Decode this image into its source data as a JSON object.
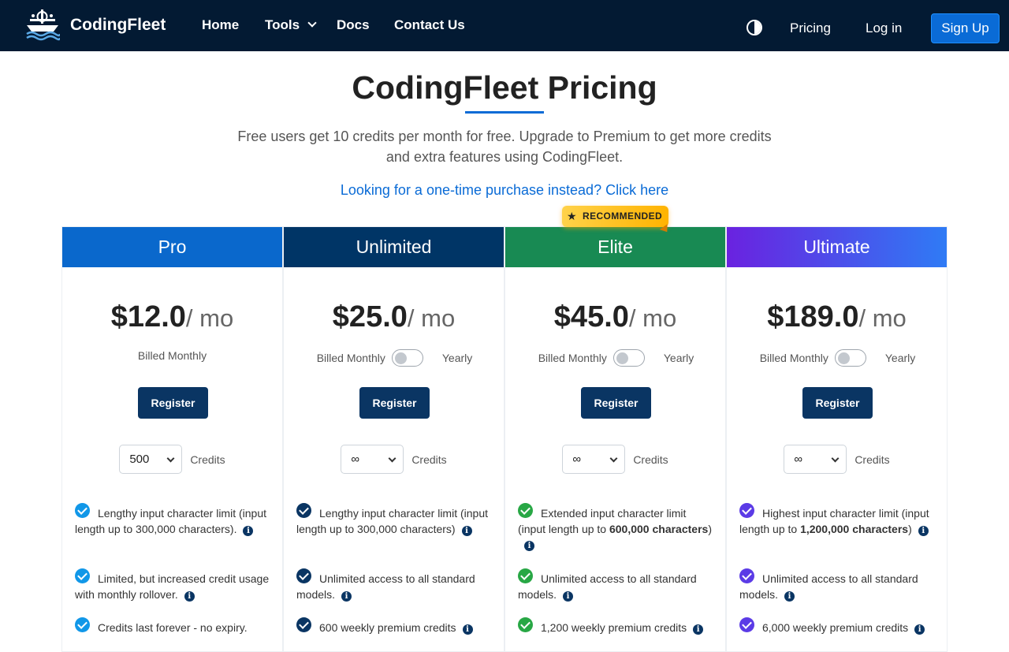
{
  "navbar": {
    "brand": "CodingFleet",
    "links": {
      "home": "Home",
      "tools": "Tools",
      "docs": "Docs",
      "contact": "Contact Us"
    },
    "pricing": "Pricing",
    "login": "Log in",
    "signup": "Sign Up"
  },
  "header": {
    "title": "CodingFleet Pricing",
    "subtitle": "Free users get 10 credits per month for free. Upgrade to Premium to get more credits and extra features using CodingFleet.",
    "onetime_link": "Looking for a one-time purchase instead? Click here"
  },
  "badge": {
    "star": "★",
    "label": "RECOMMENDED"
  },
  "common": {
    "billed_monthly": "Billed Monthly",
    "yearly": "Yearly",
    "register": "Register",
    "credits": "Credits",
    "info": "i"
  },
  "plans": [
    {
      "name": "Pro",
      "price": "$12.0",
      "unit": "/ mo",
      "credits_value": "500",
      "color": "#0a68cc",
      "check_color": "#1197e8",
      "features": [
        {
          "a": "Lengthy input character limit (input length up to 300,000 characters)."
        },
        {
          "a": "Limited, but increased credit usage with monthly rollover."
        },
        {
          "a": "Credits last forever - no expiry."
        }
      ]
    },
    {
      "name": "Unlimited",
      "price": "$25.0",
      "unit": "/ mo",
      "credits_value": "∞",
      "color": "#003566",
      "check_color": "#0a3563",
      "features": [
        {
          "a": "Lengthy input character limit (input length up to 300,000 characters)"
        },
        {
          "a": "Unlimited access to all standard models."
        },
        {
          "a": "600 weekly premium credits"
        }
      ]
    },
    {
      "name": "Elite",
      "price": "$45.0",
      "unit": "/ mo",
      "credits_value": "∞",
      "color": "#188a53",
      "check_color": "#28a745",
      "features": [
        {
          "a": "Extended input character limit (input length up to ",
          "b": "600,000 characters",
          "c": ")"
        },
        {
          "a": "Unlimited access to all standard models."
        },
        {
          "a": "1,200 weekly premium credits"
        }
      ]
    },
    {
      "name": "Ultimate",
      "price": "$189.0",
      "unit": "/ mo",
      "credits_value": "∞",
      "color": "#6a22e0",
      "check_color": "#5b3be6",
      "features": [
        {
          "a": "Highest input character limit (input length up to ",
          "b": "1,200,000 characters",
          "c": ")"
        },
        {
          "a": "Unlimited access to all standard models."
        },
        {
          "a": "6,000 weekly premium credits"
        }
      ]
    }
  ]
}
